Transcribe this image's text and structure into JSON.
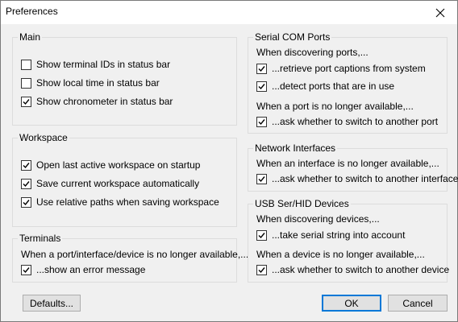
{
  "window": {
    "title": "Preferences"
  },
  "main": {
    "legend": "Main",
    "items": [
      {
        "label": "Show terminal IDs in status bar",
        "checked": false
      },
      {
        "label": "Show local time in status bar",
        "checked": false
      },
      {
        "label": "Show chronometer in status bar",
        "checked": true
      }
    ]
  },
  "workspace": {
    "legend": "Workspace",
    "items": [
      {
        "label": "Open last active workspace on startup",
        "checked": true
      },
      {
        "label": "Save current workspace automatically",
        "checked": true
      },
      {
        "label": "Use relative paths when saving workspace",
        "checked": true
      }
    ]
  },
  "terminals": {
    "legend": "Terminals",
    "text": "When a port/interface/device is no longer available,...",
    "items": [
      {
        "label": "...show an error message",
        "checked": true
      }
    ]
  },
  "serial": {
    "legend": "Serial COM Ports",
    "text1": "When discovering ports,...",
    "items1": [
      {
        "label": "...retrieve port captions from system",
        "checked": true
      },
      {
        "label": "...detect ports that are in use",
        "checked": true
      }
    ],
    "text2": "When a port is no longer available,...",
    "items2": [
      {
        "label": "...ask whether to switch to another port",
        "checked": true
      }
    ]
  },
  "network": {
    "legend": "Network Interfaces",
    "text": "When an interface is no longer available,...",
    "items": [
      {
        "label": "...ask whether to switch to another interface",
        "checked": true
      }
    ]
  },
  "usb": {
    "legend": "USB Ser/HID Devices",
    "text1": "When discovering devices,...",
    "items1": [
      {
        "label": "...take serial string into account",
        "checked": true
      }
    ],
    "text2": "When a device is no longer available,...",
    "items2": [
      {
        "label": "...ask whether to switch to another device",
        "checked": true
      }
    ]
  },
  "buttons": {
    "defaults": "Defaults...",
    "ok": "OK",
    "cancel": "Cancel"
  }
}
